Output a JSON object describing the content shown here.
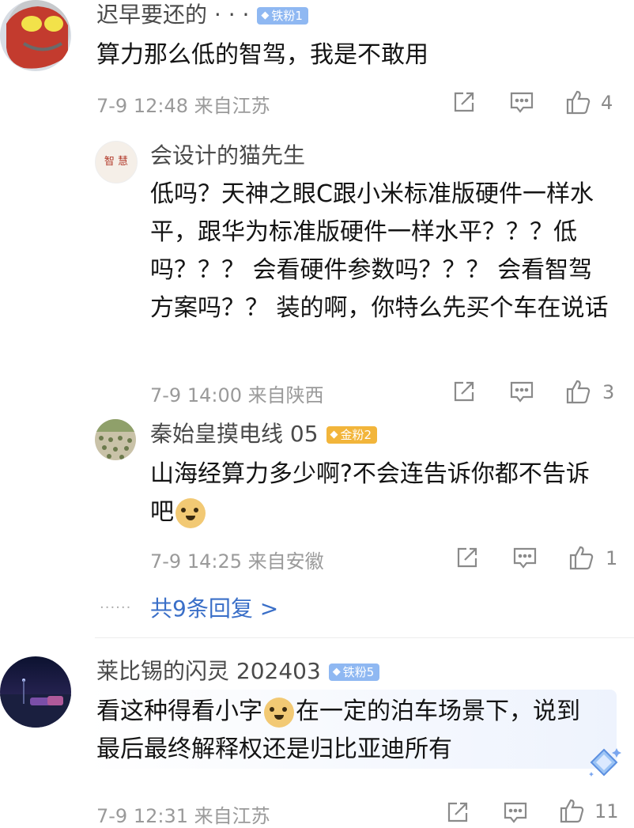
{
  "comments": [
    {
      "name": "迟早要还的 · · ·",
      "badge": "铁粉1",
      "text": "算力那么低的智驾，我是不敢用",
      "time": "7-9 12:48",
      "location": "来自江苏",
      "likes": "4"
    },
    {
      "name": "会设计的猫先生",
      "avatar_text": "智 慧",
      "text": "低吗？天神之眼C跟小米标准版硬件一样水平，跟华为标准版硬件一样水平？？？低吗？？？ 会看硬件参数吗？？？ 会看智驾方案吗？？ 装的啊，你特么先买个车在说话",
      "time": "7-9 14:00",
      "location": "来自陕西",
      "likes": "3"
    },
    {
      "name": "秦始皇摸电线 05",
      "badge": "金粉2",
      "text_before": "山海经算力多少啊?不会连告诉你都不告诉吧",
      "time": "7-9 14:25",
      "location": "来自安徽",
      "likes": "1"
    },
    {
      "name": "莱比锡的闪灵 202403",
      "badge": "铁粉5",
      "text_before": "看这种得看小字",
      "text_after": "在一定的泊车场景下，说到最后最终解释权还是归比亚迪所有",
      "time": "7-9 12:31",
      "location": "来自江苏",
      "likes": "11"
    }
  ],
  "more_replies": "共9条回复 >",
  "dots": "······"
}
